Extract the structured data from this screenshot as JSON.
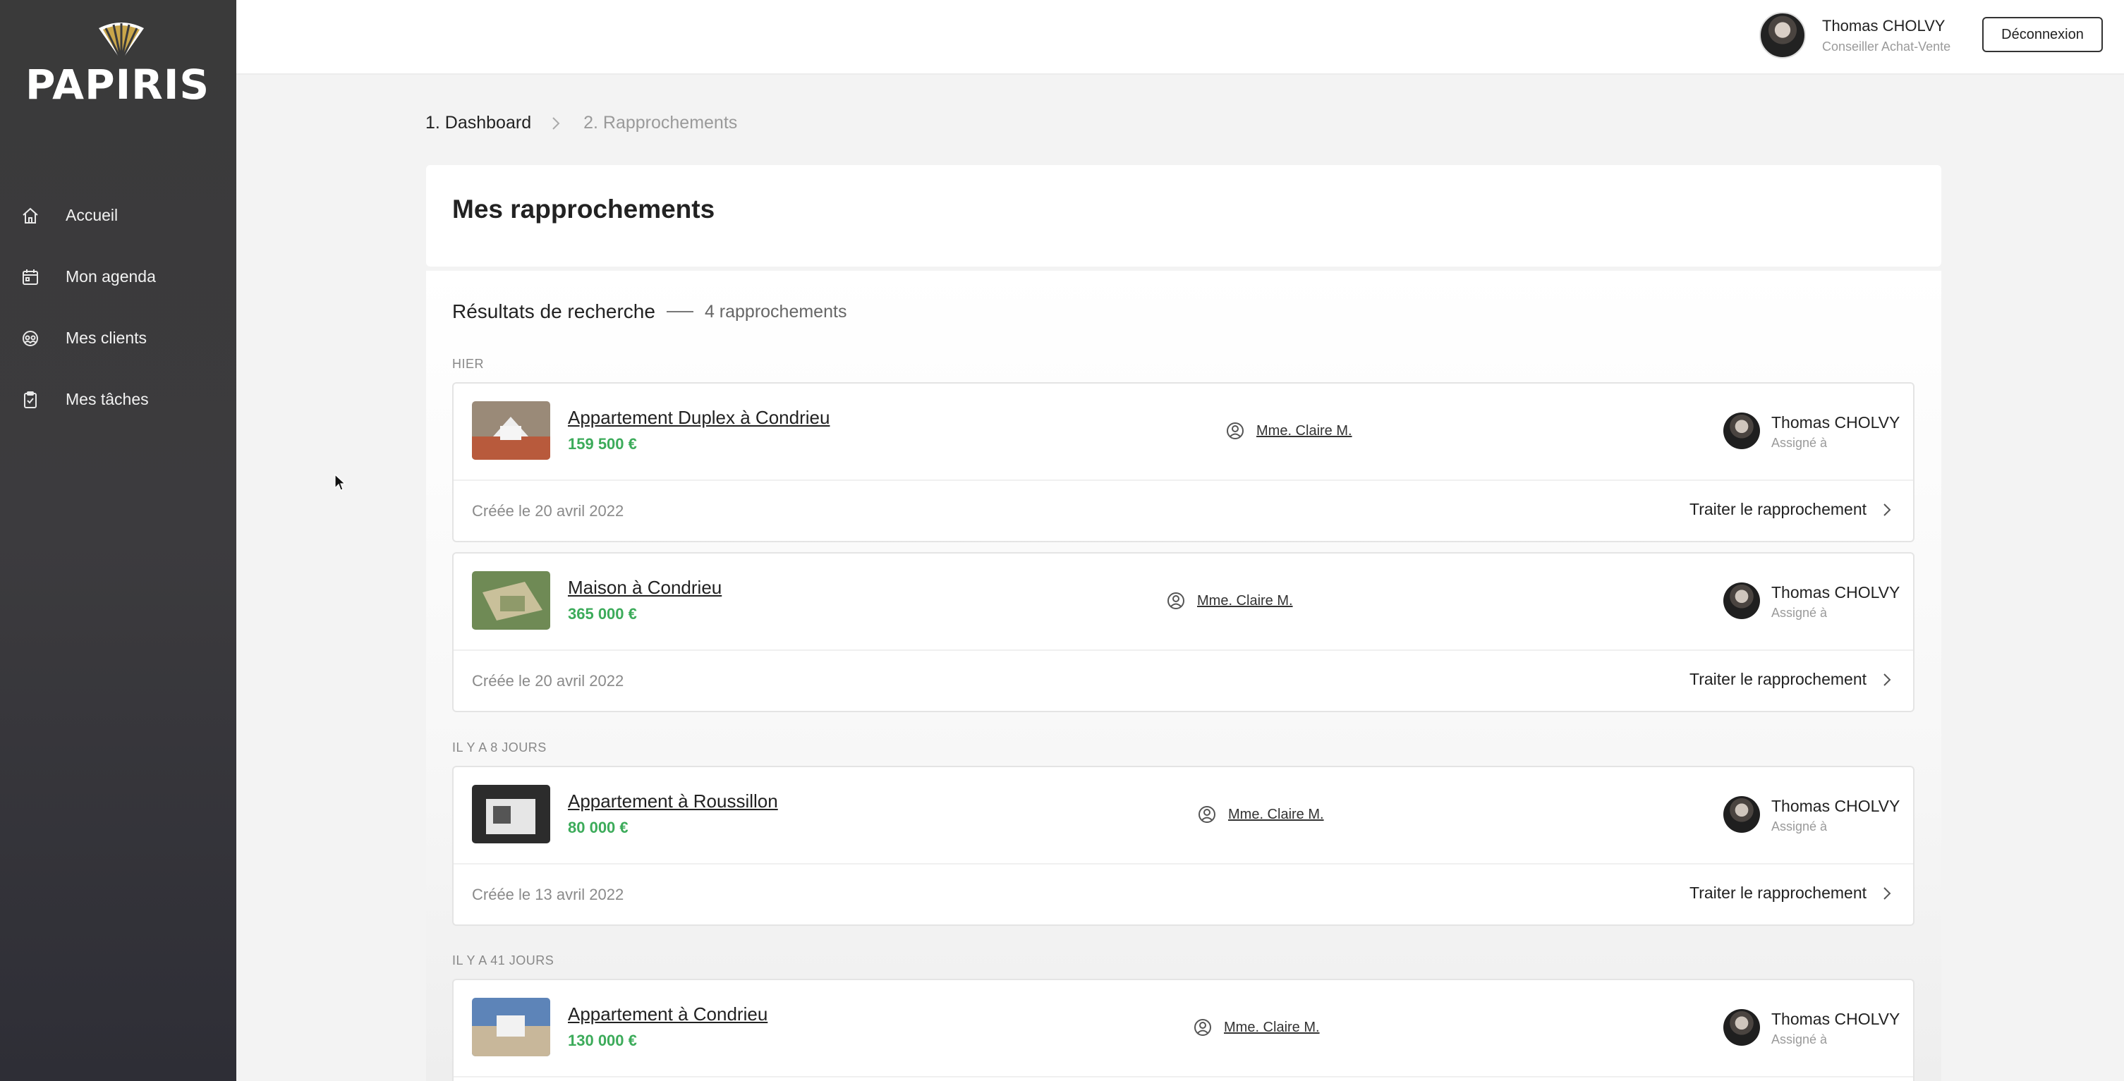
{
  "brand": {
    "logo_text": "PAPIRIS"
  },
  "sidebar": {
    "items": [
      {
        "label": "Accueil",
        "icon": "home-icon"
      },
      {
        "label": "Mon agenda",
        "icon": "calendar-icon"
      },
      {
        "label": "Mes clients",
        "icon": "clients-icon"
      },
      {
        "label": "Mes tâches",
        "icon": "clipboard-icon"
      }
    ]
  },
  "header": {
    "user_name": "Thomas CHOLVY",
    "user_role": "Conseiller Achat-Vente",
    "logout_label": "Déconnexion"
  },
  "breadcrumb": {
    "step1": "1. Dashboard",
    "step2": "2. Rapprochements"
  },
  "page": {
    "title": "Mes rapprochements",
    "results_title": "Résultats de recherche",
    "results_count": "4 rapprochements"
  },
  "groups": [
    {
      "label": "HIER"
    },
    {
      "label": "IL Y A 8 JOURS"
    },
    {
      "label": "IL Y A 41 JOURS"
    }
  ],
  "matches": [
    {
      "title": "Appartement Duplex à Condrieu",
      "price": "159 500 €",
      "client": "Mme. Claire M.",
      "assignee": "Thomas CHOLVY",
      "assignee_role": "Assigné à",
      "created": "Créée le 20 avril 2022",
      "action": "Traiter le rapprochement"
    },
    {
      "title": "Maison à Condrieu",
      "price": "365 000 €",
      "client": "Mme. Claire M.",
      "assignee": "Thomas CHOLVY",
      "assignee_role": "Assigné à",
      "created": "Créée le 20 avril 2022",
      "action": "Traiter le rapprochement"
    },
    {
      "title": "Appartement à Roussillon",
      "price": "80 000 €",
      "client": "Mme. Claire M.",
      "assignee": "Thomas CHOLVY",
      "assignee_role": "Assigné à",
      "created": "Créée le 13 avril 2022",
      "action": "Traiter le rapprochement"
    },
    {
      "title": "Appartement à Condrieu",
      "price": "130 000 €",
      "client": "Mme. Claire M.",
      "assignee": "Thomas CHOLVY",
      "assignee_role": "Assigné à"
    }
  ],
  "colors": {
    "sidebar_bg": "#3a3a3a",
    "price_green": "#3cab5a",
    "page_bg": "#f3f3f3"
  }
}
